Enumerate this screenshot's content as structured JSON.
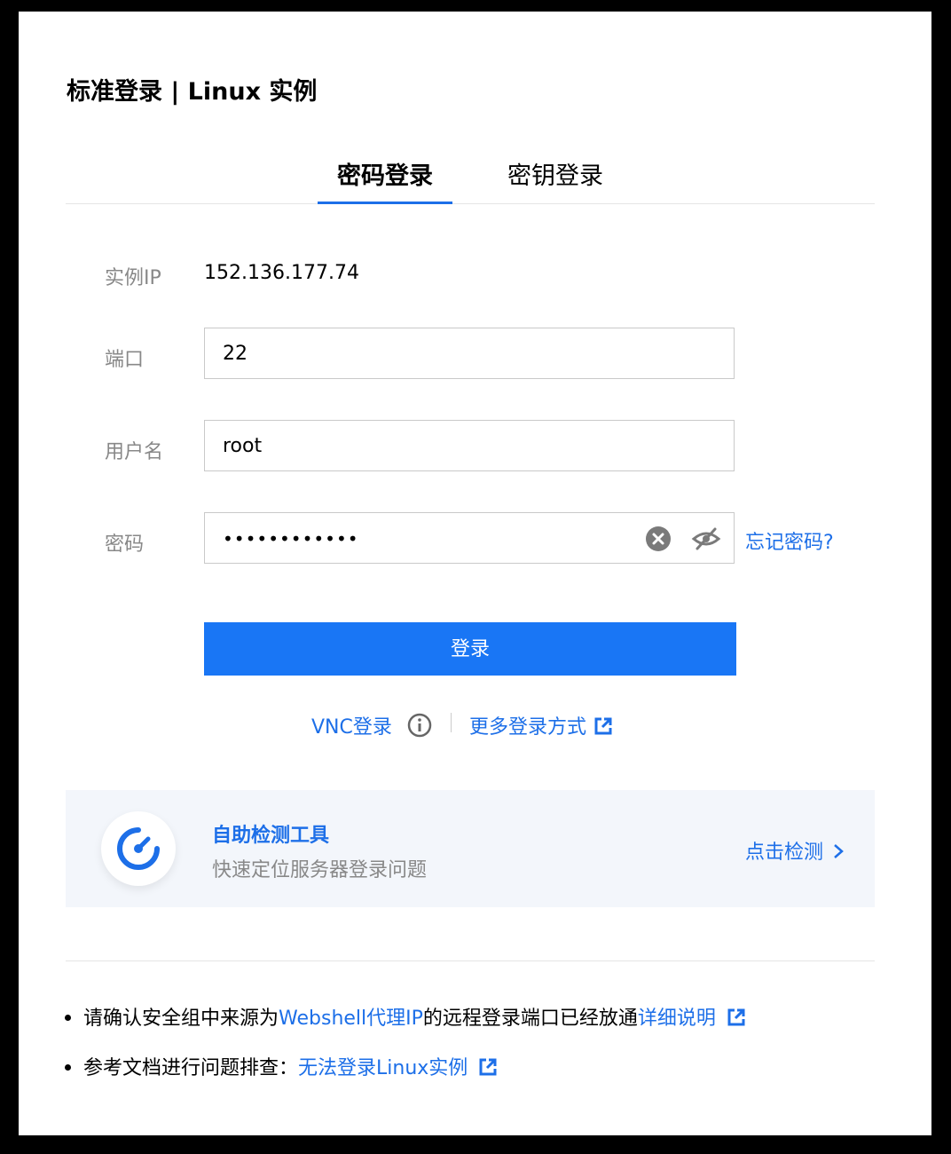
{
  "title": "标准登录 | Linux 实例",
  "tabs": [
    {
      "label": "密码登录",
      "active": true
    },
    {
      "label": "密钥登录",
      "active": false
    }
  ],
  "form": {
    "ip_label": "实例IP",
    "ip_value": "152.136.177.74",
    "port_label": "端口",
    "port_value": "22",
    "user_label": "用户名",
    "user_value": "root",
    "password_label": "密码",
    "password_value": "••••••••••••",
    "forgot_label": "忘记密码?"
  },
  "login_button": "登录",
  "alt": {
    "vnc_label": "VNC登录",
    "more_label": "更多登录方式"
  },
  "tool": {
    "title": "自助检测工具",
    "subtitle": "快速定位服务器登录问题",
    "action": "点击检测"
  },
  "notes": {
    "line1_prefix": "请确认安全组中来源为",
    "line1_link": "Webshell代理IP",
    "line1_mid": "的远程登录端口已经放通",
    "line1_detail": "详细说明",
    "line2_prefix": "参考文档进行问题排查：",
    "line2_link": "无法登录Linux实例"
  },
  "colors": {
    "accent": "#1d6fe8",
    "button": "#1976f5",
    "tool_bg": "#f3f6fb"
  },
  "icons": [
    "clear-icon",
    "eye-off-icon",
    "info-icon",
    "external-link-icon",
    "gauge-icon",
    "chevron-right-icon"
  ]
}
